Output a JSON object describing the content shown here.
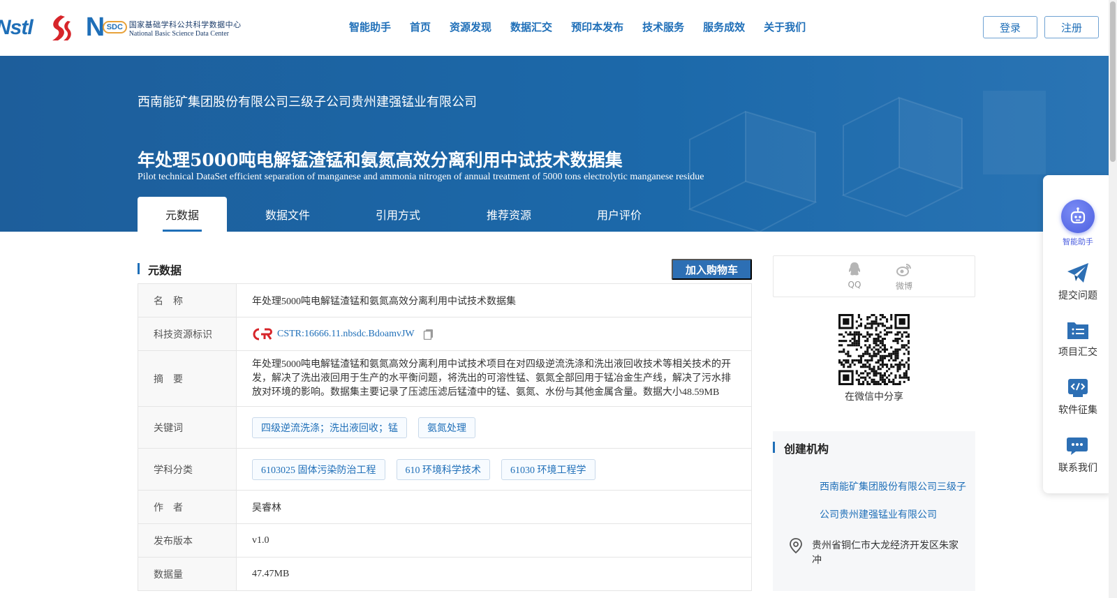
{
  "header": {
    "logos": {
      "nstl": "Nstl",
      "nsdc_mark": "SDC",
      "nsdc_cn": "国家基础学科公共科学数据中心",
      "nsdc_en": "National Basic Science Data Center"
    },
    "nav": [
      "智能助手",
      "首页",
      "资源发现",
      "数据汇交",
      "预印本发布",
      "技术服务",
      "服务成效",
      "关于我们"
    ],
    "login_label": "登录",
    "register_label": "注册"
  },
  "banner": {
    "org": "西南能矿集团股份有限公司三级子公司贵州建强锰业有限公司",
    "title_cn": "年处理5000吨电解锰渣锰和氨氮高效分离利用中试技术数据集",
    "title_en": "Pilot technical DataSet efficient separation of manganese and ammonia nitrogen of annual treatment of 5000 tons electrolytic manganese residue",
    "tabs": [
      {
        "label": "元数据",
        "active": true
      },
      {
        "label": "数据文件",
        "active": false
      },
      {
        "label": "引用方式",
        "active": false
      },
      {
        "label": "推荐资源",
        "active": false
      },
      {
        "label": "用户评价",
        "active": false
      }
    ]
  },
  "metadata": {
    "section_title": "元数据",
    "cart_label": "加入购物车",
    "rows": {
      "name": {
        "label": "名　称",
        "value": "年处理5000吨电解锰渣锰和氨氮高效分离利用中试技术数据集"
      },
      "id": {
        "label": "科技资源标识",
        "value": "CSTR:16666.11.nbsdc.BdoamvJW"
      },
      "abstract": {
        "label": "摘　要",
        "value": "年处理5000吨电解锰渣锰和氨氮高效分离利用中试技术项目在对四级逆流洗涤和洗出液回收技术等相关技术的开发，解决了洗出液回用于生产的水平衡问题，将洗出的可溶性锰、氨氮全部回用于锰冶金生产线，解决了污水排放对环境的影响。数据集主要记录了压滤压滤后锰渣中的锰、氨氮、水份与其他金属含量。数据大小48.59MB"
      },
      "keywords": {
        "label": "关键词",
        "tags": [
          "四级逆流洗涤；洗出液回收；锰",
          "氨氮处理"
        ]
      },
      "subjects": {
        "label": "学科分类",
        "tags": [
          "6103025 固体污染防治工程",
          "610 环境科学技术",
          "61030 环境工程学"
        ]
      },
      "author": {
        "label": "作　者",
        "value": "吴睿林"
      },
      "version": {
        "label": "发布版本",
        "value": "v1.0"
      },
      "size": {
        "label": "数据量",
        "value": "47.47MB"
      }
    }
  },
  "share": {
    "qq_label": "QQ",
    "weibo_label": "微博",
    "wechat_caption": "在微信中分享"
  },
  "creator": {
    "title": "创建机构",
    "org": "西南能矿集团股份有限公司三级子公司贵州建强锰业有限公司",
    "address": "贵州省铜仁市大龙经济开发区朱家冲"
  },
  "float_bar": {
    "ai_label": "智能助手",
    "items": [
      "提交问题",
      "项目汇交",
      "软件征集",
      "联系我们"
    ]
  },
  "colors": {
    "accent": "#1f6fb8",
    "banner": "#1c69aa",
    "cart": "#2d6fb4"
  }
}
